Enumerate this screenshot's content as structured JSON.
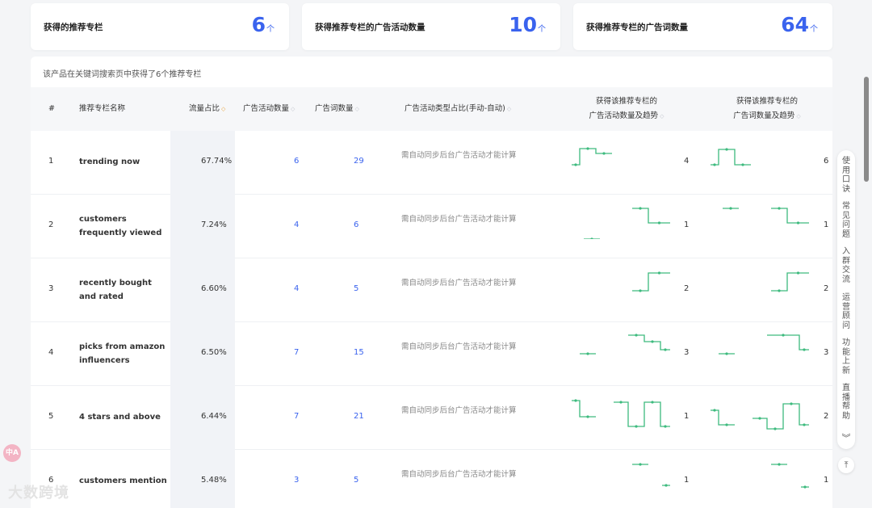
{
  "stats": [
    {
      "label": "获得的推荐专栏",
      "value": "6",
      "unit": "个"
    },
    {
      "label": "获得推荐专栏的广告活动数量",
      "value": "10",
      "unit": "个"
    },
    {
      "label": "获得推荐专栏的广告词数量",
      "value": "64",
      "unit": "个"
    }
  ],
  "table": {
    "description": "该产品在关键词搜索页中获得了6个推荐专栏",
    "headers": {
      "index": "#",
      "name": "推荐专栏名称",
      "traffic": "流量占比",
      "campaigns": "广告活动数量",
      "keywords": "广告词数量",
      "type_ratio": "广告活动类型占比(手动-自动)",
      "campaign_trend_line1": "获得该推荐专栏的",
      "campaign_trend_line2": "广告活动数量及趋势",
      "keyword_trend_line1": "获得该推荐专栏的",
      "keyword_trend_line2": "广告词数量及趋势"
    },
    "sync_text": "需自动同步后台广告活动才能计算",
    "rows": [
      {
        "index": "1",
        "name": "trending now",
        "traffic": "67.74%",
        "campaigns": "6",
        "keywords": "29",
        "campaign_trend_end": "4",
        "keyword_trend_end": "6"
      },
      {
        "index": "2",
        "name": "customers frequently viewed",
        "traffic": "7.24%",
        "campaigns": "4",
        "keywords": "6",
        "campaign_trend_end": "1",
        "keyword_trend_end": "1"
      },
      {
        "index": "3",
        "name": "recently bought and rated",
        "traffic": "6.60%",
        "campaigns": "4",
        "keywords": "5",
        "campaign_trend_end": "2",
        "keyword_trend_end": "2"
      },
      {
        "index": "4",
        "name": "picks from amazon influencers",
        "traffic": "6.50%",
        "campaigns": "7",
        "keywords": "15",
        "campaign_trend_end": "3",
        "keyword_trend_end": "3"
      },
      {
        "index": "5",
        "name": "4 stars and above",
        "traffic": "6.44%",
        "campaigns": "7",
        "keywords": "21",
        "campaign_trend_end": "1",
        "keyword_trend_end": "2"
      },
      {
        "index": "6",
        "name": "customers mention",
        "traffic": "5.48%",
        "campaigns": "3",
        "keywords": "5",
        "campaign_trend_end": "1",
        "keyword_trend_end": "1"
      }
    ]
  },
  "sidebar_tools": [
    "使用口诀",
    "常见问题",
    "入群交流",
    "运营顾问",
    "功能上新",
    "直播帮助"
  ],
  "icons": {
    "sort": "sort-icon",
    "collapse": "chevron-double-down-icon",
    "back_top": "arrow-up-icon"
  },
  "badge_text": "中A",
  "watermark_text": "大数跨境",
  "colors": {
    "accent": "#3a63ee",
    "spark": "#3dba7e",
    "sort_active": "#e8a33d"
  }
}
